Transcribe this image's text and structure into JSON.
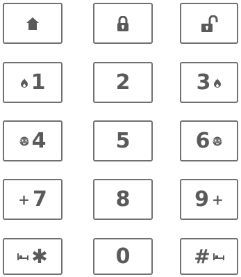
{
  "keypad": {
    "row1": [
      {
        "name": "home-button",
        "icon": "home-icon"
      },
      {
        "name": "lock-button",
        "icon": "lock-icon"
      },
      {
        "name": "unlock-button",
        "icon": "unlock-icon"
      }
    ],
    "row2": [
      {
        "label": "1",
        "icon": "fire-icon"
      },
      {
        "label": "2"
      },
      {
        "label": "3",
        "icon": "fire-icon"
      }
    ],
    "row3": [
      {
        "label": "4",
        "icon": "burglar-mask-icon"
      },
      {
        "label": "5"
      },
      {
        "label": "6",
        "icon": "burglar-mask-icon"
      }
    ],
    "row4": [
      {
        "label": "7",
        "modifier": "+"
      },
      {
        "label": "8"
      },
      {
        "label": "9",
        "modifier": "+"
      }
    ],
    "row5": [
      {
        "label": "✱",
        "icon": "bed-icon"
      },
      {
        "label": "0"
      },
      {
        "label": "#",
        "icon": "bed-icon"
      }
    ]
  },
  "colors": {
    "border": "#707070",
    "text": "#5a5a5a",
    "background": "#ffffff"
  }
}
